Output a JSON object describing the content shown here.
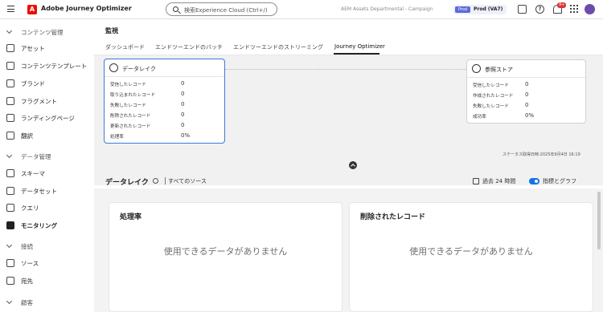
{
  "header": {
    "app_title": "Adobe Journey Optimizer",
    "logo_text": "A",
    "search_placeholder": "検索Experience Cloud (Ctrl+/)",
    "org_name": "AEM Assets Departmental - Campaign",
    "sandbox_badge": "Prod",
    "sandbox_name": "Prod (VA7)",
    "notification_count": "9+"
  },
  "sidebar": {
    "items": [
      {
        "kind": "section",
        "label": "コンテンツ管理"
      },
      {
        "kind": "item",
        "label": "アセット",
        "icon": "assets-icon"
      },
      {
        "kind": "item",
        "label": "コンテンツテンプレート",
        "icon": "template-icon"
      },
      {
        "kind": "item",
        "label": "ブランド",
        "icon": "brand-icon"
      },
      {
        "kind": "item",
        "label": "フラグメント",
        "icon": "fragment-icon"
      },
      {
        "kind": "item",
        "label": "ランディングページ",
        "icon": "landing-page-icon"
      },
      {
        "kind": "item",
        "label": "翻訳",
        "icon": "globe-icon"
      },
      {
        "kind": "section",
        "label": "データ管理"
      },
      {
        "kind": "item",
        "label": "スキーマ",
        "icon": "schema-icon"
      },
      {
        "kind": "item",
        "label": "データセット",
        "icon": "dataset-icon"
      },
      {
        "kind": "item",
        "label": "クエリ",
        "icon": "query-icon"
      },
      {
        "kind": "item",
        "label": "モニタリング",
        "icon": "monitoring-icon",
        "active": true
      },
      {
        "kind": "section",
        "label": "接続"
      },
      {
        "kind": "item",
        "label": "ソース",
        "icon": "source-icon"
      },
      {
        "kind": "item",
        "label": "宛先",
        "icon": "destination-icon"
      },
      {
        "kind": "section",
        "label": "顧客"
      }
    ]
  },
  "main": {
    "page_title": "監視",
    "tabs": [
      {
        "label": "ダッシュボード"
      },
      {
        "label": "エンドツーエンドのバッチ"
      },
      {
        "label": "エンドツーエンドのストリーミング"
      },
      {
        "label": "Journey Optimizer",
        "active": true
      }
    ],
    "data_lake_node": {
      "title": "データレイク",
      "rows": [
        {
          "label": "受信したレコード",
          "value": "0"
        },
        {
          "label": "取り込まれたレコード",
          "value": "0"
        },
        {
          "label": "失敗したレコード",
          "value": "0"
        },
        {
          "label": "削除されたレコード",
          "value": "0"
        },
        {
          "label": "更新されたレコード",
          "value": "0"
        },
        {
          "label": "処理率",
          "value": "0%"
        }
      ]
    },
    "profile_store_node": {
      "title": "参照ストア",
      "rows": [
        {
          "label": "受信したレコード",
          "value": "0"
        },
        {
          "label": "作成されたレコード",
          "value": "0"
        },
        {
          "label": "失敗したレコード",
          "value": "0"
        },
        {
          "label": "成功率",
          "value": "0%"
        }
      ]
    },
    "status_time": "ステータス取得日時:2025年9月4日 16:19",
    "section_title": "データレイク",
    "source_link": "すべてのソース",
    "time_range": "過去 24 時間",
    "toggle_label": "指標とグラフ",
    "cards": [
      {
        "title": "処理率",
        "empty": "使用できるデータがありません"
      },
      {
        "title": "削除されたレコード",
        "empty": "使用できるデータがありません"
      }
    ]
  }
}
